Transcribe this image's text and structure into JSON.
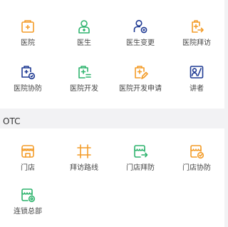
{
  "colors": {
    "orange": "#f39c28",
    "green": "#2fb46e",
    "navy": "#1f3a93",
    "label": "#444444",
    "section_bg": "#f2f2f4"
  },
  "top_grid": {
    "items": [
      {
        "label": "医院",
        "icon": "hospital-icon"
      },
      {
        "label": "医生",
        "icon": "doctor-icon"
      },
      {
        "label": "医生变更",
        "icon": "doctor-change-icon"
      },
      {
        "label": "医院拜访",
        "icon": "hospital-visit-icon"
      },
      {
        "label": "医院协防",
        "icon": "hospital-assist-icon"
      },
      {
        "label": "医院开发",
        "icon": "hospital-develop-icon"
      },
      {
        "label": "医院开发申请",
        "icon": "develop-apply-icon"
      },
      {
        "label": "讲者",
        "icon": "speaker-icon"
      }
    ]
  },
  "otc": {
    "title": "OTC",
    "items": [
      {
        "label": "门店",
        "icon": "store-icon"
      },
      {
        "label": "拜访路线",
        "icon": "visit-route-icon"
      },
      {
        "label": "门店拜防",
        "icon": "store-visit-icon"
      },
      {
        "label": "门店协防",
        "icon": "store-assist-icon"
      },
      {
        "label": "连锁总部",
        "icon": "chain-hq-icon"
      }
    ]
  }
}
